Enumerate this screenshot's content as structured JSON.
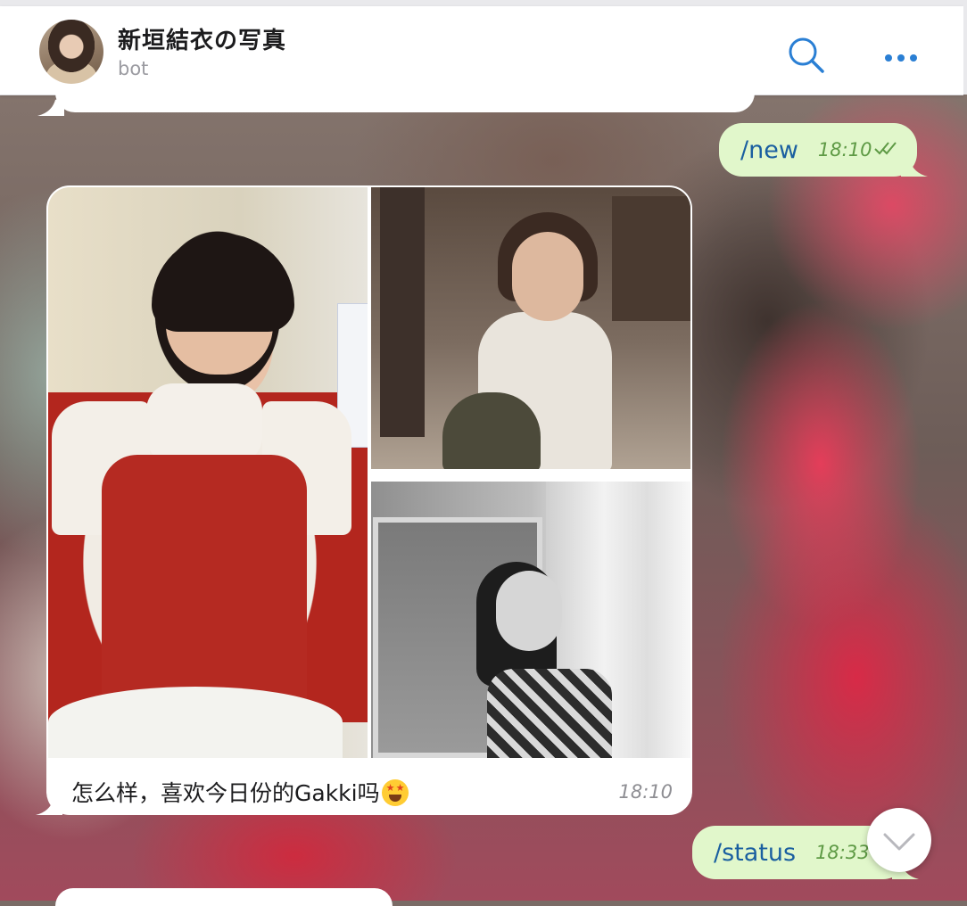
{
  "header": {
    "title": "新垣結衣の写真",
    "subtitle": "bot",
    "avatar_icon": "avatar-photo",
    "search_icon": "search-icon",
    "more_icon": "more-dots-icon",
    "accent_color": "#2a7fd4"
  },
  "messages": [
    {
      "direction": "outgoing",
      "text": "/new",
      "time": "18:10",
      "status": "read"
    },
    {
      "direction": "incoming",
      "media": [
        "photo-kitchen-apron",
        "photo-sitting-floor",
        "photo-window-bw"
      ],
      "caption": "怎么样，喜欢今日份的Gakki吗",
      "caption_emoji": "star-struck-emoji",
      "time": "18:10"
    },
    {
      "direction": "outgoing",
      "text": "/status",
      "time": "18:33",
      "status": "sent"
    }
  ],
  "controls": {
    "scroll_down_icon": "chevron-down-icon"
  },
  "colors": {
    "outgoing_bubble": "#e1f7cb",
    "outgoing_text": "#1a5fa0",
    "outgoing_time": "#5e9a45",
    "incoming_bubble": "#ffffff"
  }
}
